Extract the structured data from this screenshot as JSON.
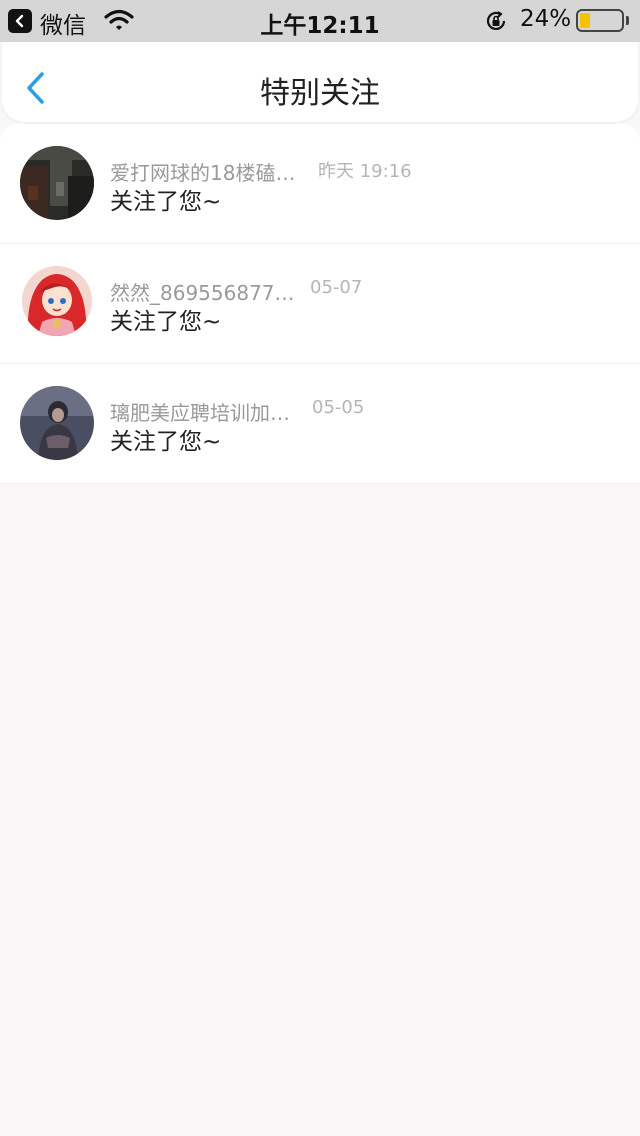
{
  "status_bar": {
    "back_app": "微信",
    "time": "上午12:11",
    "battery": "24%",
    "battery_level": 0.24,
    "icons": [
      "back-arrow-icon",
      "wifi-icon",
      "rotation-lock-icon",
      "battery-icon"
    ]
  },
  "nav": {
    "title": "特别关注",
    "back_icon": "chevron-left-icon",
    "accent": "#2b9fe6"
  },
  "items": [
    {
      "name": "爱打网球的18楼磕…",
      "time": "昨天 19:16",
      "message": "关注了您~"
    },
    {
      "name": "然然_869556877…",
      "time": "05-07",
      "message": "关注了您~"
    },
    {
      "name": "璃肥美应聘培训加…",
      "time": "05-05",
      "message": "关注了您~"
    }
  ]
}
